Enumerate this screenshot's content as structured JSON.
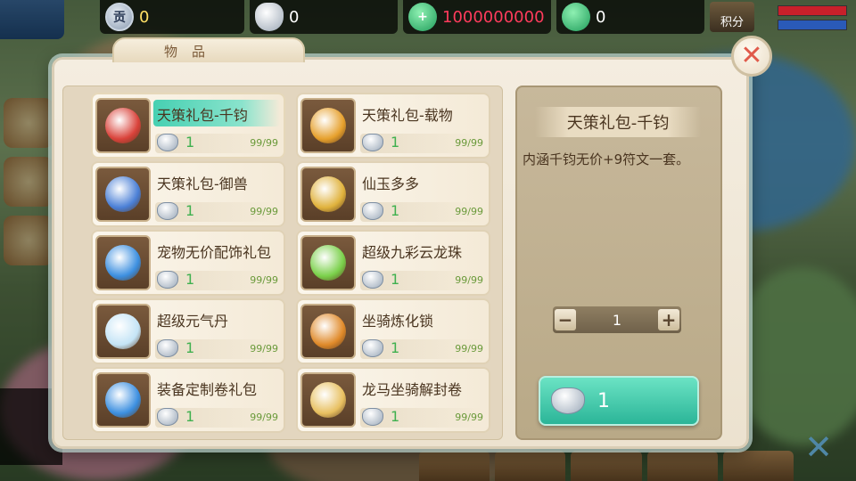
{
  "top_bar": {
    "gong_icon": "贡",
    "gong_value": "0",
    "silver_value": "0",
    "jade_value": "1000000000",
    "locked_jade_value": "0",
    "points_label": "积分"
  },
  "dialog": {
    "tab_title": "物品",
    "close_icon": "close-icon"
  },
  "items": [
    {
      "name": "天策礼包-千钧",
      "price": "1",
      "stock": "99/99",
      "color": "#d9423a"
    },
    {
      "name": "天策礼包-载物",
      "price": "1",
      "stock": "99/99",
      "color": "#e6a02c"
    },
    {
      "name": "天策礼包-御兽",
      "price": "1",
      "stock": "99/99",
      "color": "#4a7fd6"
    },
    {
      "name": "仙玉多多",
      "price": "1",
      "stock": "99/99",
      "color": "#e0b23c"
    },
    {
      "name": "宠物无价配饰礼包",
      "price": "1",
      "stock": "99/99",
      "color": "#3c8fe0"
    },
    {
      "name": "超级九彩云龙珠",
      "price": "1",
      "stock": "99/99",
      "color": "#7ad04a"
    },
    {
      "name": "超级元气丹",
      "price": "1",
      "stock": "99/99",
      "color": "#c4e4f6"
    },
    {
      "name": "坐骑炼化锁",
      "price": "1",
      "stock": "99/99",
      "color": "#e08a2a"
    },
    {
      "name": "装备定制卷礼包",
      "price": "1",
      "stock": "99/99",
      "color": "#3c8fe0"
    },
    {
      "name": "龙马坐骑解封卷",
      "price": "1",
      "stock": "99/99",
      "color": "#e8c060"
    }
  ],
  "detail": {
    "title": "天策礼包-千钧",
    "description": "内涵千钧无价+9符文一套。",
    "quantity": "1",
    "minus": "−",
    "plus": "+",
    "buy_price": "1"
  }
}
